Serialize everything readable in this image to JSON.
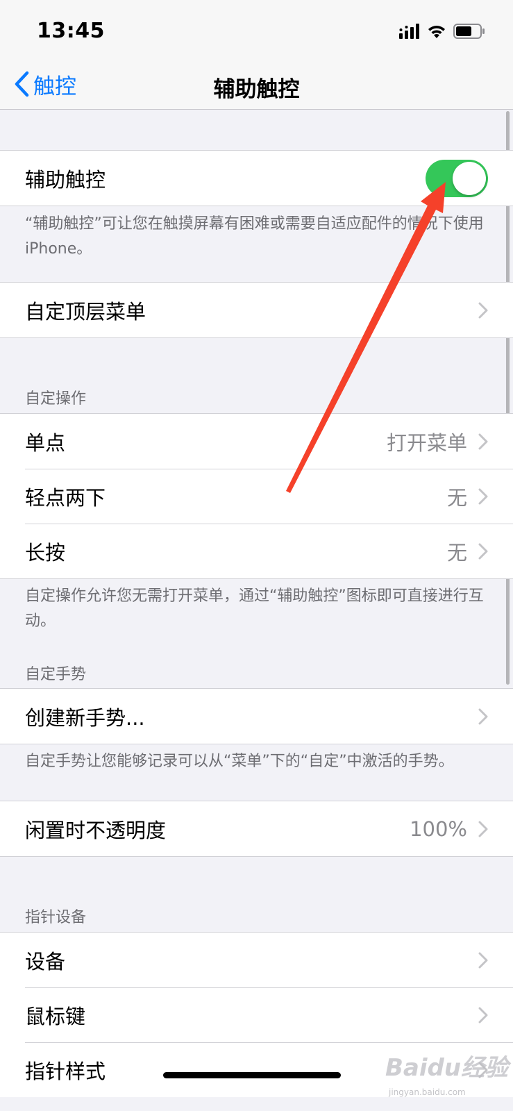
{
  "status_bar": {
    "time": "13:45"
  },
  "nav": {
    "back_label": "触控",
    "title": "辅助触控"
  },
  "main_toggle": {
    "label": "辅助触控",
    "on": true,
    "color": "#34c759"
  },
  "main_toggle_note": "“辅助触控”可让您在触摸屏幕有困难或需要自适应配件的情况下使用iPhone。",
  "top_menu": {
    "label": "自定顶层菜单"
  },
  "custom_actions": {
    "header": "自定操作",
    "rows": [
      {
        "label": "单点",
        "value": "打开菜单"
      },
      {
        "label": "轻点两下",
        "value": "无"
      },
      {
        "label": "长按",
        "value": "无"
      }
    ],
    "note": "自定操作允许您无需打开菜单，通过“辅助触控”图标即可直接进行互动。"
  },
  "custom_gestures": {
    "header": "自定手势",
    "create_label": "创建新手势...",
    "note": "自定手势让您能够记录可以从“菜单”下的“自定”中激活的手势。"
  },
  "idle_opacity": {
    "label": "闲置时不透明度",
    "value": "100%"
  },
  "pointer_devices": {
    "header": "指针设备",
    "rows": [
      {
        "label": "设备"
      },
      {
        "label": "鼠标键"
      },
      {
        "label": "指针样式"
      }
    ]
  },
  "watermark": {
    "text": "Baidu经验",
    "sub": "jingyan.baidu.com"
  },
  "colors": {
    "accent": "#0a7aff",
    "toggle_on": "#34c759",
    "annotation_arrow": "#f5412a"
  }
}
